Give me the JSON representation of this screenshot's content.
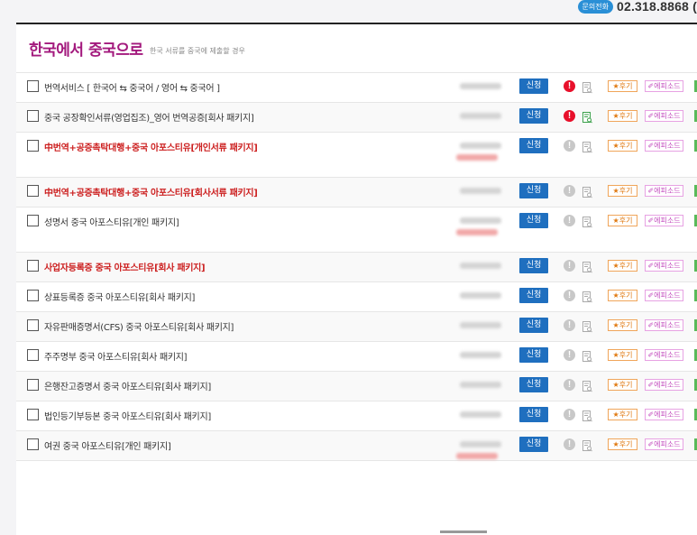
{
  "contact": {
    "badge": "문의전화",
    "phone": "02.318.8868 (",
    "badge_color": "#2a8fd6"
  },
  "section": {
    "title": "한국에서 중국으로",
    "subtitle": "한국 서류를 중국에 제출할 경우",
    "title_color": "#a3197d"
  },
  "labels": {
    "apply": "신청",
    "review": "★후기",
    "episode": "✐에피소드",
    "alert": "!"
  },
  "colors": {
    "apply_bg": "#1f6fbf",
    "alert_active": "#e8102b",
    "alert_inactive": "#c8c8c8",
    "highlight_text": "#cc1f1f"
  },
  "rows": [
    {
      "name": "번역서비스 [ 한국어 ⇆ 중국어 / 영어 ⇆ 중국어 ]",
      "highlight": false,
      "tall": false,
      "sale": false,
      "alert": true,
      "doc_active": false
    },
    {
      "name": "중국 공장확인서류(영업집조)_영어 번역공증[회사 패키지]",
      "highlight": false,
      "tall": false,
      "sale": false,
      "alert": true,
      "doc_active": true
    },
    {
      "name": "中번역+공증촉탁대행+중국 아포스티유[개인서류 패키지]",
      "highlight": true,
      "tall": true,
      "sale": true,
      "alert": false,
      "doc_active": false
    },
    {
      "name": "中번역+공증촉탁대행+중국 아포스티유[회사서류 패키지]",
      "highlight": true,
      "tall": false,
      "sale": false,
      "alert": false,
      "doc_active": false
    },
    {
      "name": "성명서 중국 아포스티유[개인 패키지]",
      "highlight": false,
      "tall": true,
      "sale": true,
      "alert": false,
      "doc_active": false
    },
    {
      "name": "사업자등록증 중국 아포스티유[회사 패키지]",
      "highlight": true,
      "tall": false,
      "sale": false,
      "alert": false,
      "doc_active": false
    },
    {
      "name": "상표등록증 중국 아포스티유[회사 패키지]",
      "highlight": false,
      "tall": false,
      "sale": false,
      "alert": false,
      "doc_active": false
    },
    {
      "name": "자유판매증명서(CFS) 중국 아포스티유[회사 패키지]",
      "highlight": false,
      "tall": false,
      "sale": false,
      "alert": false,
      "doc_active": false
    },
    {
      "name": "주주명부 중국 아포스티유[회사 패키지]",
      "highlight": false,
      "tall": false,
      "sale": false,
      "alert": false,
      "doc_active": false
    },
    {
      "name": "은행잔고증명서 중국 아포스티유[회사 패키지]",
      "highlight": false,
      "tall": false,
      "sale": false,
      "alert": false,
      "doc_active": false
    },
    {
      "name": "법인등기부등본 중국 아포스티유[회사 패키지]",
      "highlight": false,
      "tall": false,
      "sale": false,
      "alert": false,
      "doc_active": false
    },
    {
      "name": "여권 중국 아포스티유[개인 패키지]",
      "highlight": false,
      "tall": false,
      "sale": true,
      "alert": false,
      "doc_active": false
    }
  ]
}
